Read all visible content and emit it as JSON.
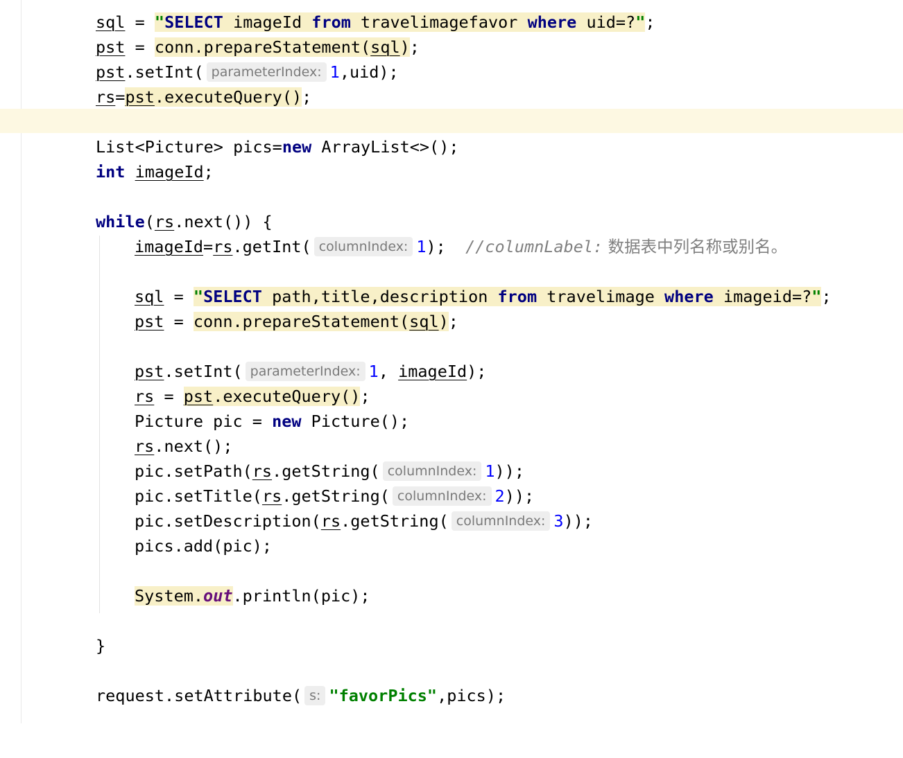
{
  "editor": {
    "lines": {
      "l1": {
        "a": "sql",
        "b": " = ",
        "c": "\"",
        "d": "SELECT",
        "e": " imageId ",
        "f": "from",
        "g": " travelimagefavor ",
        "h": "where",
        "i": " uid=?",
        "j": "\"",
        "k": ";"
      },
      "l2": {
        "a": "pst",
        "b": " = ",
        "c": "conn.prepareStatement(",
        "d": "sql",
        "e": ")",
        "f": ";"
      },
      "l3": {
        "a": "pst",
        "b": ".setInt(",
        "hint": "parameterIndex:",
        "c": "1",
        "d": ",uid);"
      },
      "l4": {
        "a": "rs",
        "b": "=",
        "c": "pst",
        "d": ".executeQuery()",
        "e": ";"
      },
      "l5": {},
      "l6": {
        "a": "List<Picture> pics=",
        "b": "new",
        "c": " ArrayList<>();"
      },
      "l7": {
        "a": "int",
        "b": " ",
        "c": "imageId",
        "d": ";"
      },
      "l8": {},
      "l9": {
        "a": "while",
        "b": "(",
        "c": "rs",
        "d": ".next()) {"
      },
      "l10": {
        "a": "imageId",
        "b": "=",
        "c": "rs",
        "d": ".getInt(",
        "hint": "columnIndex:",
        "e": "1",
        "f": ");  ",
        "g": "//columnLabel:",
        "h": " 数据表中列名称或别名。"
      },
      "l11": {},
      "l12": {
        "a": "sql",
        "b": " = ",
        "c": "\"",
        "d": "SELECT",
        "e": " path,title,description ",
        "f": "from",
        "g": " travelimage ",
        "h": "where",
        "i": " imageid=?",
        "j": "\"",
        "k": ";"
      },
      "l13": {
        "a": "pst",
        "b": " = ",
        "c": "conn.prepareStatement(",
        "d": "sql",
        "e": ")",
        "f": ";"
      },
      "l14": {},
      "l15": {
        "a": "pst",
        "b": ".setInt(",
        "hint": "parameterIndex:",
        "c": "1",
        "d": ", ",
        "e": "imageId",
        "f": ");"
      },
      "l16": {
        "a": "rs",
        "b": " = ",
        "c": "pst",
        "d": ".executeQuery()",
        "e": ";"
      },
      "l17": {
        "a": "Picture pic = ",
        "b": "new",
        "c": " Picture();"
      },
      "l18": {
        "a": "rs",
        "b": ".next();"
      },
      "l19": {
        "a": "pic.setPath(",
        "b": "rs",
        "c": ".getString(",
        "hint": "columnIndex:",
        "d": "1",
        "e": "));"
      },
      "l20": {
        "a": "pic.setTitle(",
        "b": "rs",
        "c": ".getString(",
        "hint": "columnIndex:",
        "d": "2",
        "e": "));"
      },
      "l21": {
        "a": "pic.setDescription(",
        "b": "rs",
        "c": ".getString(",
        "hint": "columnIndex:",
        "d": "3",
        "e": "));"
      },
      "l22": {
        "a": "pics.add(pic);"
      },
      "l23": {},
      "l24": {
        "a": "System.",
        "b": "out",
        "c": ".println(pic);"
      },
      "l25": {},
      "l26": {
        "a": "}"
      },
      "l27": {},
      "l28": {
        "a": "request.setAttribute(",
        "hint": "s:",
        "b": "\"favorPics\"",
        "c": ",pics);"
      }
    }
  },
  "colors": {
    "keyword": "#000080",
    "string": "#008000",
    "number": "#0000ff",
    "comment": "#808080",
    "static_field": "#660e7a",
    "highlight": "#f8f0c8",
    "caret_row": "#fdf8e2"
  }
}
